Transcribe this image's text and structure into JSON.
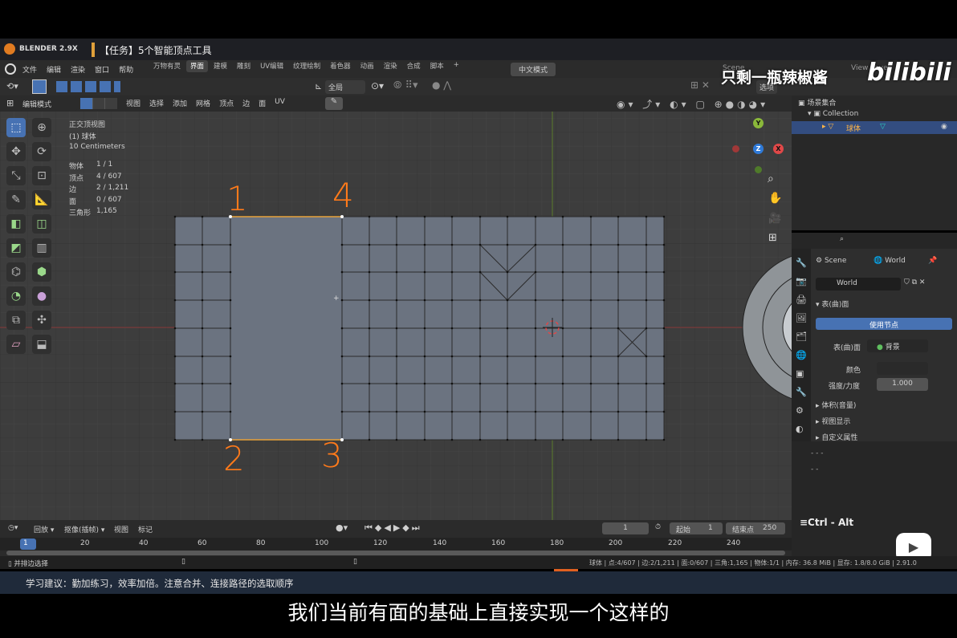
{
  "titlebar": {
    "app_badge": "BLENDER 2.9X",
    "task_title": "【任务】5个智能顶点工具"
  },
  "watermark": {
    "text": "只剩一瓶辣椒酱",
    "logo": "bilibili"
  },
  "menu": {
    "items": [
      "文件",
      "编辑",
      "渲染",
      "窗口",
      "帮助"
    ],
    "tabs": [
      "万物有灵",
      "界面",
      "建模",
      "雕刻",
      "UV编辑",
      "纹理绘制",
      "着色器",
      "动画",
      "渲染",
      "合成",
      "脚本"
    ],
    "active_tab": "界面",
    "lang_mode": "中文模式",
    "scene": "Scene",
    "view_layer": "View Layer"
  },
  "header2": {
    "transform_orient": "全局",
    "options": "选项"
  },
  "header3": {
    "mode": "编辑模式",
    "menus": [
      "视图",
      "选择",
      "添加",
      "网格",
      "顶点",
      "边",
      "面",
      "UV"
    ]
  },
  "overlay_info": {
    "view_name": "正交顶视图",
    "object": "(1) 球体",
    "scale": "10 Centimeters",
    "stats": [
      {
        "label": "物体",
        "value": "1 / 1"
      },
      {
        "label": "顶点",
        "value": "4 / 607"
      },
      {
        "label": "边",
        "value": "2 / 1,211"
      },
      {
        "label": "面",
        "value": "0 / 607"
      },
      {
        "label": "三角形",
        "value": "1,165"
      }
    ]
  },
  "annotations": [
    "1",
    "4",
    "2",
    "3"
  ],
  "gizmo": {
    "y": "Y",
    "z": "Z",
    "x": "X"
  },
  "outliner": {
    "root": "场景集合",
    "collection": "Collection",
    "object": "球体"
  },
  "properties": {
    "breadcrumb_scene": "Scene",
    "breadcrumb_world": "World",
    "world_name": "World",
    "surface_section": "表(曲)面",
    "use_nodes": "使用节点",
    "surface_label": "表(曲)面",
    "surface_value": "背景",
    "color_label": "颜色",
    "strength_label": "强度/力度",
    "strength_value": "1.000",
    "collapsed": [
      "体积(音量)",
      "视图显示",
      "自定义属性"
    ]
  },
  "keys_overlay": {
    "text": "≡Ctrl - Alt",
    "dashes1": "-   - -",
    "dashes2": "-   -"
  },
  "timeline": {
    "playback": "回放",
    "keying": "抠像(插帧)",
    "view": "视图",
    "marker": "标记",
    "current_frame": "1",
    "start_label": "起始",
    "start": "1",
    "end_label": "结束点",
    "end": "250",
    "ticks": [
      "1",
      "20",
      "40",
      "60",
      "80",
      "100",
      "120",
      "140",
      "160",
      "180",
      "200",
      "220",
      "240"
    ]
  },
  "statusbar": {
    "left": "并排边选择",
    "right": "球体 | 点:4/607 | 边:2/1,211 | 面:0/607 | 三角:1,165 | 物体:1/1 | 内存: 36.8 MiB | 显存: 1.8/8.0 GiB | 2.91.0"
  },
  "tip": {
    "text": "学习建议：勤加练习，效率加倍。注意合并、连接路径的选取顺序"
  },
  "subtitle": {
    "text": "我们当前有面的基础上直接实现一个这样的"
  },
  "colors": {
    "accent": "#4772b3",
    "orange": "#ff7a1a",
    "viewport": "#3d3d3d",
    "mesh": "#6b7380"
  }
}
